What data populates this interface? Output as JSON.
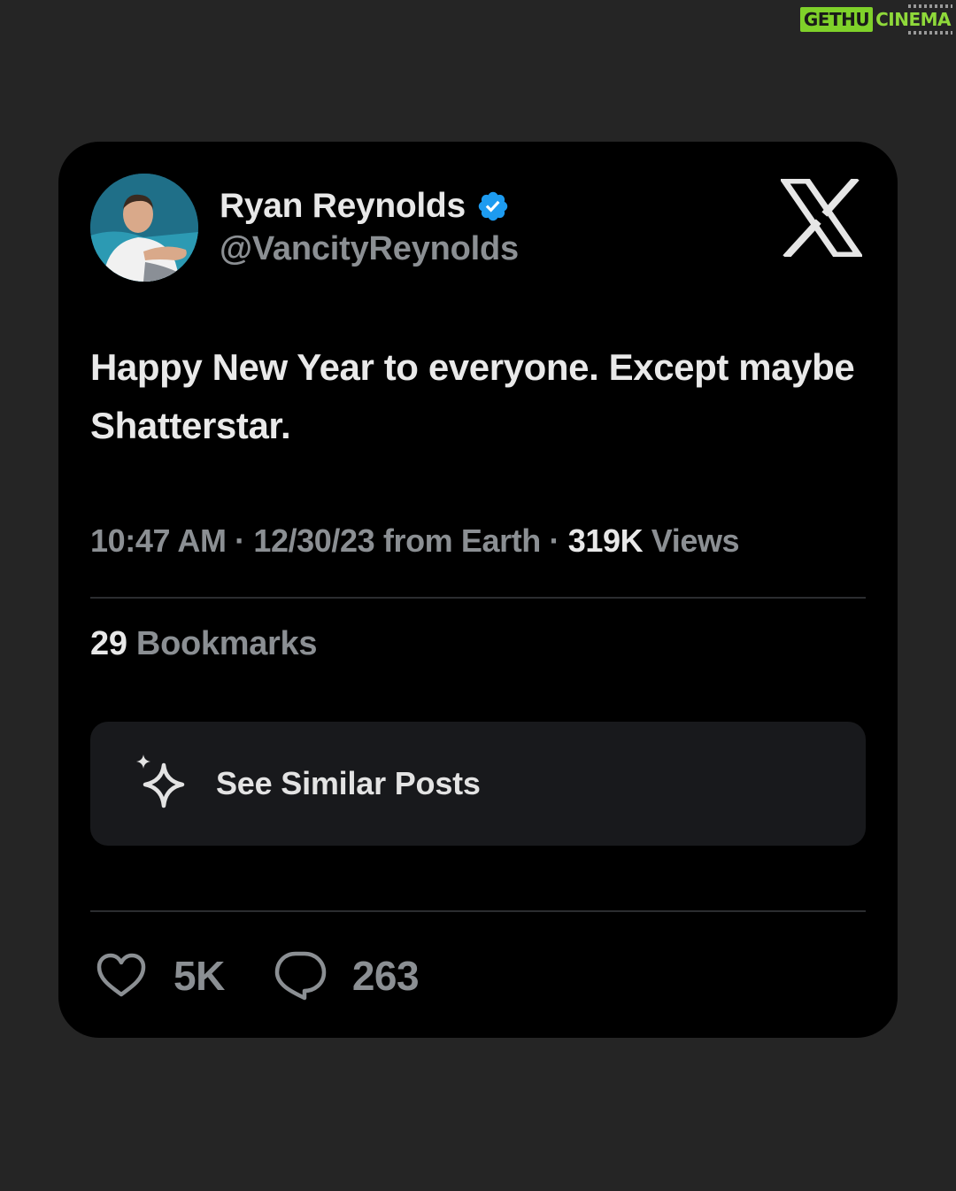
{
  "watermark": {
    "part1": "GETHU",
    "part2": "CINEMA"
  },
  "post": {
    "author_name": "Ryan Reynolds",
    "handle": "@VancityReynolds",
    "verified": true,
    "platform_icon": "x-logo-icon",
    "text": "Happy New Year to everyone. Except maybe Shatterstar.",
    "time": "10:47 AM",
    "date": "12/30/23",
    "location": "from Earth",
    "separator": " · ",
    "views_count": "319K",
    "views_label": " Views",
    "bookmarks_count": "29",
    "bookmarks_label": " Bookmarks"
  },
  "similar_button": {
    "icon": "sparkle-icon",
    "label": "See Similar Posts"
  },
  "actions": {
    "likes": {
      "icon": "heart-icon",
      "count": "5K"
    },
    "replies": {
      "icon": "reply-bubble-icon",
      "count": "263"
    }
  },
  "colors": {
    "page_bg": "#252525",
    "card_bg": "#000000",
    "verified_blue": "#1d9bf0",
    "text_primary": "#e8e8e8",
    "text_secondary": "#8b8f93",
    "button_bg": "#18191c",
    "watermark_green": "#7fd12a"
  }
}
